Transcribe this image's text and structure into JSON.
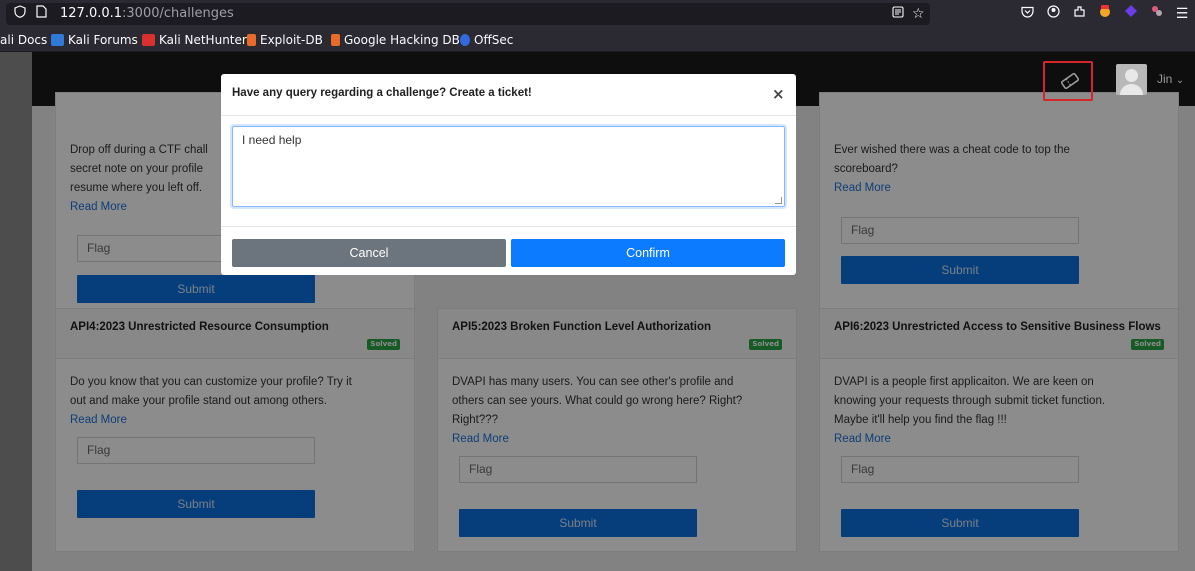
{
  "browser": {
    "url_host": "127.0.0.1",
    "url_path": ":3000/challenges",
    "bookmarks": [
      {
        "label": "ali Docs",
        "color": "#2f7bd8"
      },
      {
        "label": "Kali Forums",
        "color": "#2f7bd8"
      },
      {
        "label": "Kali NetHunter",
        "color": "#d93030"
      },
      {
        "label": "Exploit-DB",
        "color": "#e86b2a"
      },
      {
        "label": "Google Hacking DB",
        "color": "#e86b2a"
      },
      {
        "label": "OffSec",
        "color": "#2f6bdf"
      }
    ],
    "icons": [
      "shield-icon",
      "page-icon",
      "reader-icon",
      "star-icon",
      "pocket-icon",
      "account-icon",
      "extensions-icon",
      "menu-icon"
    ]
  },
  "navbar": {
    "user_name": "Jin",
    "dropdown_glyph": "⌄",
    "ticket_icon": "ticket-icon"
  },
  "cards": [
    {
      "title": "",
      "solved": false,
      "desc_lines": [
        "Drop off during a CTF chall",
        "secret note on your profile",
        "resume where you left off."
      ],
      "read_more": "Read More",
      "flag_placeholder": "Flag",
      "submit_label": "Submit"
    },
    {
      "title": "",
      "solved": false,
      "desc_lines": [
        "Ever wished there was a cheat code to top the",
        "scoreboard?"
      ],
      "read_more": "Read More",
      "flag_placeholder": "Flag",
      "submit_label": "Submit"
    },
    {
      "title": "API4:2023 Unrestricted Resource Consumption",
      "solved": true,
      "badge": "Solved",
      "desc_lines": [
        "Do you know that you can customize your profile? Try it",
        "out and make your profile stand out among others."
      ],
      "read_more": "Read More",
      "flag_placeholder": "Flag",
      "submit_label": "Submit"
    },
    {
      "title": "API5:2023 Broken Function Level Authorization",
      "solved": true,
      "badge": "Solved",
      "desc_lines": [
        "DVAPI has many users. You can see other's profile and",
        "others can see yours. What could go wrong here? Right?",
        "Right???"
      ],
      "read_more": "Read More",
      "flag_placeholder": "Flag",
      "submit_label": "Submit"
    },
    {
      "title": "API6:2023 Unrestricted Access to Sensitive Business Flows",
      "solved": true,
      "badge": "Solved",
      "desc_lines": [
        "DVAPI is a people first applicaiton. We are keen on",
        "knowing your requests through submit ticket function.",
        "Maybe it'll help you find the flag !!!"
      ],
      "read_more": "Read More",
      "flag_placeholder": "Flag",
      "submit_label": "Submit"
    }
  ],
  "modal": {
    "title": "Have any query regarding a challenge? Create a ticket!",
    "close_glyph": "×",
    "textarea_value": "I need help",
    "cancel_label": "Cancel",
    "confirm_label": "Confirm"
  },
  "colors": {
    "accent": "#0d7bff",
    "solved_badge": "#28a745",
    "cancel": "#6c757d",
    "highlight_box": "#d3272b"
  }
}
